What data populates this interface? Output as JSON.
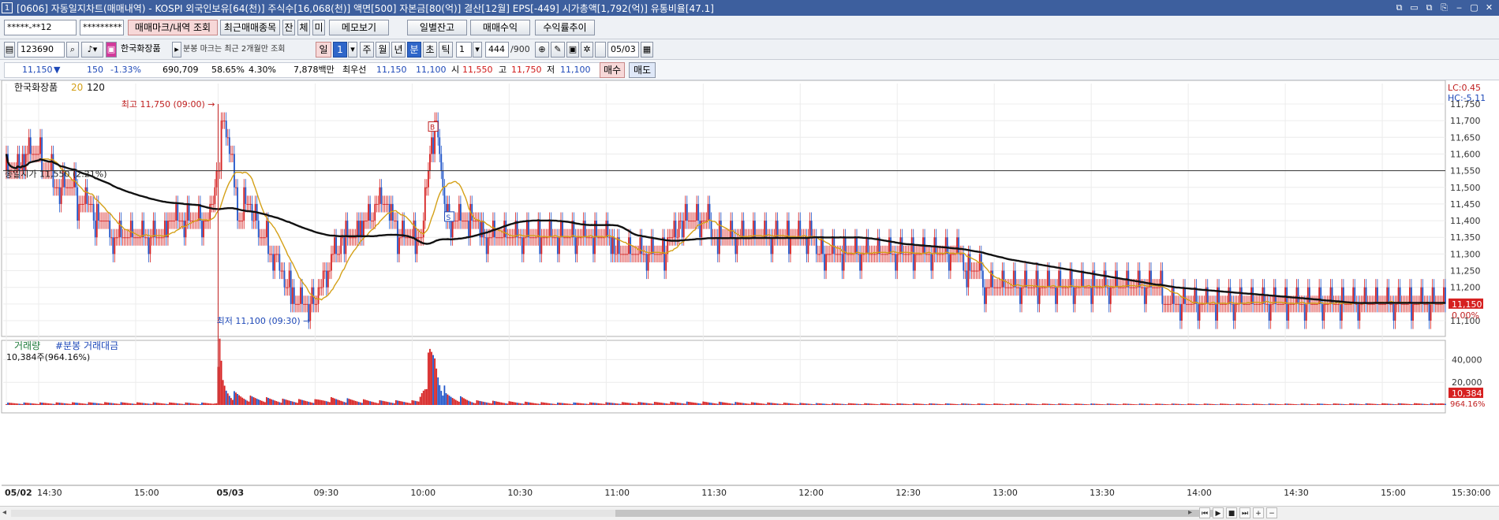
{
  "window": {
    "number": "1",
    "title": "[0606] 자동일지차트(매매내역) - KOSPI 외국인보유[64(천)] 주식수[16,068(천)] 액면[500] 자본금[80(억)] 결산[12월] EPS[-449] 시가총액[1,792(억)] 유통비율[47.1]",
    "controls": [
      "⧉",
      "▭",
      "⧉",
      "⎘",
      "‒",
      "▢",
      "✕"
    ]
  },
  "toolbar1": {
    "account": "*****-**12",
    "password": "*********",
    "btn_marks": "매매마크/내역 조회",
    "btn_recent": "최근매매종목",
    "btn_jan": "잔",
    "btn_che": "체",
    "btn_mi": "미",
    "btn_memo": "메모보기",
    "btn_daily": "일별잔고",
    "btn_profit": "매매수익",
    "btn_rate": "수익률추이"
  },
  "toolbar2": {
    "code": "123690",
    "stock_name": "한국화장품",
    "note": "분봉 마크는 최근 2개월만 조회",
    "period_day": "일",
    "period_num": "1",
    "period_week": "주",
    "period_month": "월",
    "period_year": "년",
    "period_min": "분",
    "period_sec": "초",
    "period_tick": "틱",
    "interval": "1",
    "count": "444",
    "count_total": "/900",
    "date": "05/03"
  },
  "quote": {
    "price": "11,150",
    "arrow": "▼",
    "change": "150",
    "rate": "-1.33%",
    "volume": "690,709",
    "vol_ratio": "58.65%",
    "turnover": "4.30%",
    "amount": "7,878백만",
    "best_label": "최우선",
    "best_ask": "11,150",
    "best_bid": "11,100",
    "open_label": "시",
    "open": "11,550",
    "high_label": "고",
    "high": "11,750",
    "low_label": "저",
    "low": "11,100",
    "buy": "매수",
    "sell": "매도"
  },
  "chart_data": {
    "type": "candlestick",
    "title": "한국화장품",
    "ma_periods": [
      "20",
      "120"
    ],
    "ma_colors": {
      "20": "#d4a017",
      "120": "#111111"
    },
    "up_color": "#d62020",
    "down_color": "#1f55c9",
    "ylim": [
      11100,
      11750
    ],
    "y_ticks": [
      "11,100",
      "11,150",
      "11,200",
      "11,250",
      "11,300",
      "11,350",
      "11,400",
      "11,450",
      "11,500",
      "11,550",
      "11,600",
      "11,650",
      "11,700",
      "11,750"
    ],
    "lc_label": "LC:0.45",
    "hc_label": "HC:-5.11",
    "open_line": {
      "value": 11550,
      "label": "종일시가 11,550 (2.21%)"
    },
    "high_marker": {
      "value": 11750,
      "label": "최고 11,750 (09:00)"
    },
    "low_marker": {
      "value": 11100,
      "label": "최저 11,100 (09:30)"
    },
    "buy_mark": "B",
    "sell_mark": "S",
    "last_price": "11,150",
    "last_pct": "0.00%",
    "volume_title": "거래량",
    "volume_sub": "#분봉 거래대금",
    "volume_info": "10,384주(964.16%)",
    "vol_ylim": [
      0,
      50000
    ],
    "vol_ticks": [
      "20,000",
      "40,000"
    ],
    "last_volume": "10,384",
    "last_vol_pct": "964.16%",
    "x_labels": [
      {
        "i": 0,
        "t": "05/02",
        "bold": true
      },
      {
        "i": 20,
        "t": "14:30"
      },
      {
        "i": 80,
        "t": "15:00"
      },
      {
        "i": 131,
        "t": "05/03",
        "bold": true
      },
      {
        "i": 191,
        "t": "09:30"
      },
      {
        "i": 251,
        "t": "10:00"
      },
      {
        "i": 311,
        "t": "10:30"
      },
      {
        "i": 371,
        "t": "11:00"
      },
      {
        "i": 431,
        "t": "11:30"
      },
      {
        "i": 491,
        "t": "12:00"
      },
      {
        "i": 551,
        "t": "12:30"
      },
      {
        "i": 611,
        "t": "13:00"
      },
      {
        "i": 671,
        "t": "13:30"
      },
      {
        "i": 731,
        "t": "14:00"
      },
      {
        "i": 791,
        "t": "14:30"
      },
      {
        "i": 851,
        "t": "15:00"
      }
    ],
    "x_end_label": "15:30:00",
    "anchors": [
      [
        0,
        11550
      ],
      [
        12,
        11580
      ],
      [
        22,
        11580
      ],
      [
        32,
        11500
      ],
      [
        50,
        11460
      ],
      [
        58,
        11380
      ],
      [
        75,
        11360
      ],
      [
        95,
        11370
      ],
      [
        110,
        11390
      ],
      [
        125,
        11380
      ],
      [
        132,
        11600
      ],
      [
        134,
        11720
      ],
      [
        136,
        11650
      ],
      [
        140,
        11550
      ],
      [
        144,
        11400
      ],
      [
        150,
        11450
      ],
      [
        156,
        11360
      ],
      [
        165,
        11300
      ],
      [
        172,
        11220
      ],
      [
        180,
        11150
      ],
      [
        190,
        11140
      ],
      [
        196,
        11220
      ],
      [
        205,
        11320
      ],
      [
        215,
        11360
      ],
      [
        225,
        11400
      ],
      [
        232,
        11470
      ],
      [
        240,
        11380
      ],
      [
        250,
        11330
      ],
      [
        258,
        11380
      ],
      [
        262,
        11620
      ],
      [
        265,
        11700
      ],
      [
        268,
        11600
      ],
      [
        272,
        11420
      ],
      [
        280,
        11400
      ],
      [
        290,
        11380
      ],
      [
        300,
        11360
      ],
      [
        320,
        11350
      ],
      [
        345,
        11370
      ],
      [
        370,
        11340
      ],
      [
        385,
        11300
      ],
      [
        400,
        11300
      ],
      [
        410,
        11330
      ],
      [
        418,
        11400
      ],
      [
        425,
        11420
      ],
      [
        432,
        11390
      ],
      [
        445,
        11340
      ],
      [
        470,
        11330
      ],
      [
        490,
        11330
      ],
      [
        510,
        11320
      ],
      [
        540,
        11320
      ],
      [
        560,
        11300
      ],
      [
        590,
        11280
      ],
      [
        605,
        11220
      ],
      [
        625,
        11220
      ],
      [
        650,
        11200
      ],
      [
        670,
        11190
      ],
      [
        700,
        11180
      ],
      [
        730,
        11170
      ],
      [
        760,
        11160
      ],
      [
        780,
        11160
      ],
      [
        800,
        11170
      ],
      [
        830,
        11170
      ],
      [
        860,
        11160
      ],
      [
        890,
        11150
      ]
    ],
    "vol_anchors": [
      [
        0,
        1500
      ],
      [
        60,
        1800
      ],
      [
        128,
        1500
      ],
      [
        130,
        3000
      ],
      [
        132,
        45000
      ],
      [
        134,
        20000
      ],
      [
        136,
        14000
      ],
      [
        140,
        9000
      ],
      [
        150,
        6000
      ],
      [
        170,
        4000
      ],
      [
        190,
        3500
      ],
      [
        200,
        5000
      ],
      [
        230,
        3000
      ],
      [
        255,
        3000
      ],
      [
        262,
        38000
      ],
      [
        265,
        41000
      ],
      [
        268,
        25000
      ],
      [
        272,
        8000
      ],
      [
        290,
        3000
      ],
      [
        340,
        1500
      ],
      [
        430,
        2200
      ],
      [
        500,
        1200
      ],
      [
        600,
        1000
      ],
      [
        700,
        900
      ],
      [
        800,
        900
      ],
      [
        885,
        1200
      ],
      [
        888,
        2000
      ]
    ]
  }
}
